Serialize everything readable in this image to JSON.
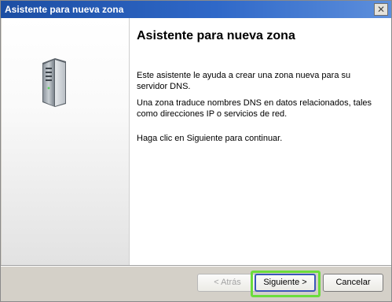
{
  "window": {
    "title": "Asistente para nueva zona",
    "close_symbol": "✕"
  },
  "content": {
    "heading": "Asistente para nueva zona",
    "paragraph1": "Este asistente le ayuda a crear una zona nueva para su servidor DNS.",
    "paragraph2": "Una zona traduce nombres DNS en datos relacionados, tales como direcciones IP o servicios de red.",
    "paragraph3": "Haga clic en Siguiente para continuar."
  },
  "buttons": {
    "back": "< Atrás",
    "next": "Siguiente >",
    "cancel": "Cancelar"
  },
  "icons": {
    "server": "server-icon",
    "close": "close-icon"
  },
  "colors": {
    "titlebar": "#2f68c8",
    "highlight": "#6bdc3c",
    "default_button_border": "#3b56b9"
  }
}
